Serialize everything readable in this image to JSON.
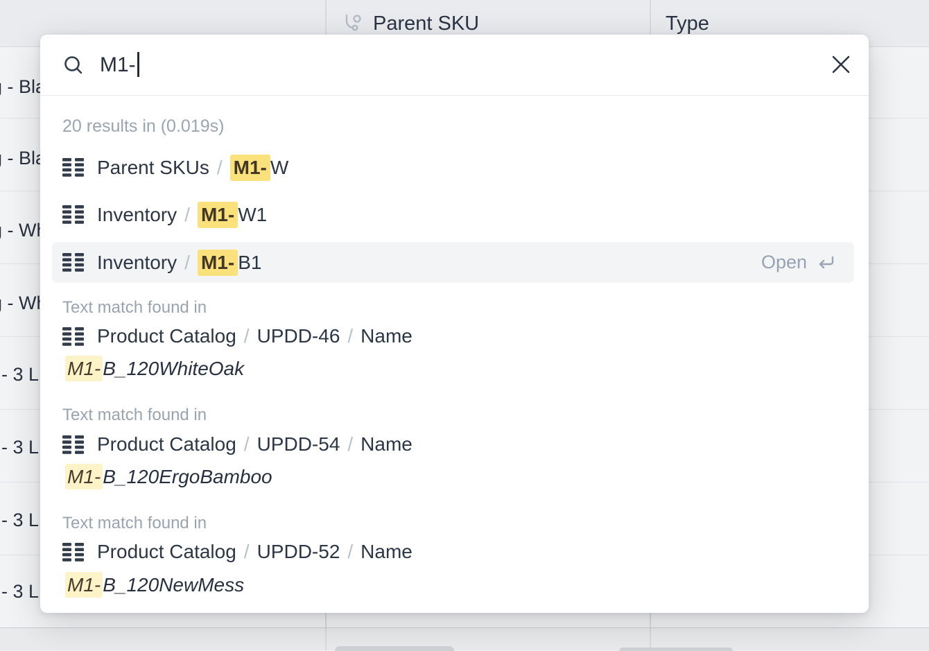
{
  "background": {
    "header": {
      "columns": [
        {
          "label": "Parent SKU",
          "icon": "link-row-icon"
        },
        {
          "label": "Type"
        }
      ]
    },
    "rows": [
      {
        "visible_text": "g - Bla"
      },
      {
        "visible_text": "g - Bla"
      },
      {
        "visible_text": "g - Wh"
      },
      {
        "visible_text": "g - Wh"
      },
      {
        "visible_text": "- 3 L"
      },
      {
        "visible_text": "- 3 L"
      },
      {
        "visible_text": "- 3 L"
      },
      {
        "visible_text": "- 3 L"
      }
    ]
  },
  "modal": {
    "search": {
      "query": "M1-"
    },
    "summary": "20 results in (0.019s)",
    "sep": "/",
    "open_label": "Open",
    "results": [
      {
        "crumb": "Parent SKUs",
        "match": "M1-",
        "rest": "W",
        "selected": false
      },
      {
        "crumb": "Inventory",
        "match": "M1-",
        "rest": "W1",
        "selected": false
      },
      {
        "crumb": "Inventory",
        "match": "M1-",
        "rest": "B1",
        "selected": true
      }
    ],
    "matches": [
      {
        "label": "Text match found in",
        "table": "Product Catalog",
        "record": "UPDD-46",
        "field": "Name",
        "match": "M1-",
        "rest": "B_120WhiteOak"
      },
      {
        "label": "Text match found in",
        "table": "Product Catalog",
        "record": "UPDD-54",
        "field": "Name",
        "match": "M1-",
        "rest": "B_120ErgoBamboo"
      },
      {
        "label": "Text match found in",
        "table": "Product Catalog",
        "record": "UPDD-52",
        "field": "Name",
        "match": "M1-",
        "rest": "B_120NewMess"
      }
    ]
  },
  "colors": {
    "highlight_strong": "#fbe17c",
    "highlight_soft": "#fcf3c8",
    "selected_row_bg": "#f3f4f6",
    "text_dark": "#28303f",
    "text_gray": "#9aa4af"
  }
}
